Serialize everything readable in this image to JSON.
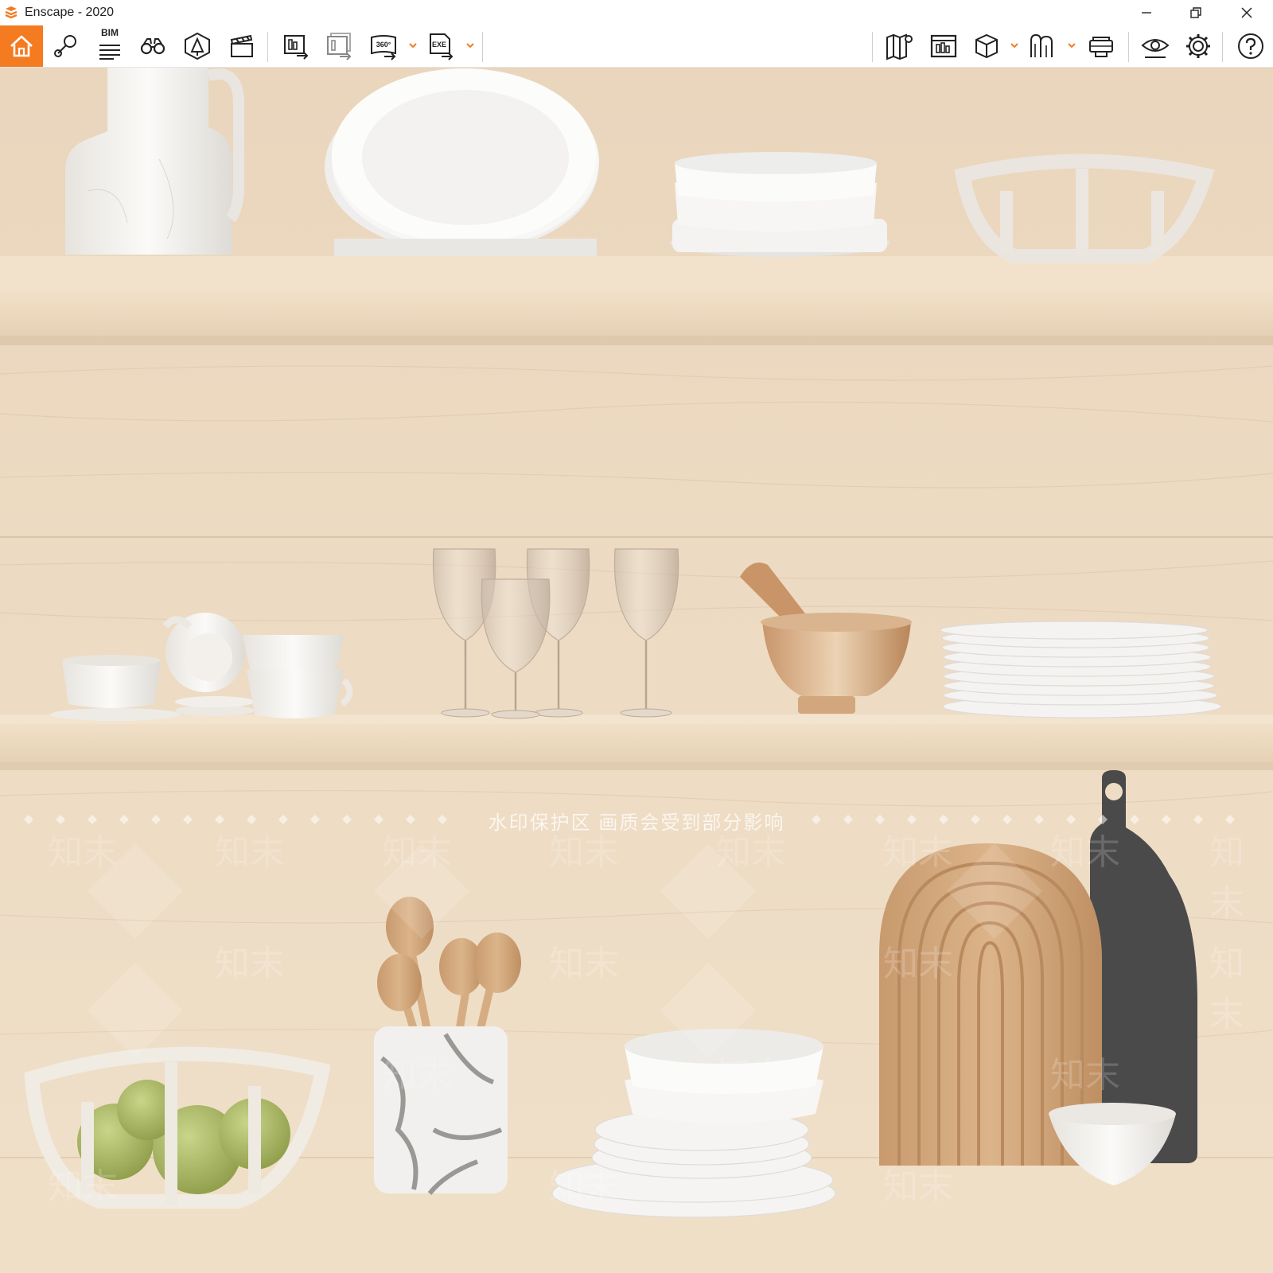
{
  "window": {
    "app_name": "Enscape",
    "title": "Enscape - 2020",
    "brand_color": "#f47b20",
    "controls": {
      "minimize_icon": "minimize-icon",
      "restore_icon": "restore-icon",
      "close_icon": "close-icon"
    }
  },
  "toolbar": {
    "left": [
      {
        "id": "home",
        "icon": "home-icon",
        "active": true
      },
      {
        "id": "view-management",
        "icon": "location-pin-icon"
      },
      {
        "id": "bim",
        "icon": "bim-list-icon",
        "label": "BIM"
      },
      {
        "id": "walk-mode",
        "icon": "binoculars-icon"
      },
      {
        "id": "assets",
        "icon": "asset-library-icon"
      },
      {
        "id": "video-editor",
        "icon": "clapperboard-icon"
      },
      {
        "id": "screenshot-export",
        "icon": "export-image-icon"
      },
      {
        "id": "batch-export",
        "icon": "batch-export-icon"
      },
      {
        "id": "panorama-export",
        "icon": "panorama-360-icon",
        "label": "360°",
        "has_dropdown": true
      },
      {
        "id": "exe-export",
        "icon": "exe-export-icon",
        "label": "EXE",
        "has_dropdown": true
      }
    ],
    "right": [
      {
        "id": "map",
        "icon": "map-icon"
      },
      {
        "id": "web-standalone",
        "icon": "web-export-icon"
      },
      {
        "id": "view-cube",
        "icon": "cube-icon",
        "has_dropdown": true
      },
      {
        "id": "materials",
        "icon": "material-editor-icon",
        "has_dropdown": true
      },
      {
        "id": "vr-headset",
        "icon": "vr-headset-icon"
      },
      {
        "id": "visual-settings",
        "icon": "eye-icon"
      },
      {
        "id": "settings",
        "icon": "gear-icon"
      },
      {
        "id": "help",
        "icon": "help-icon"
      }
    ],
    "collapse_icon": "chevron-up-icon"
  },
  "viewport": {
    "watermark_banner": "水印保护区   画质会受到部分影响",
    "watermark_mark": "知末",
    "scene_colors": {
      "wall": "#efdcc4",
      "shelf": "#f1dfc6",
      "porcelain": "#f4f2ee"
    }
  }
}
